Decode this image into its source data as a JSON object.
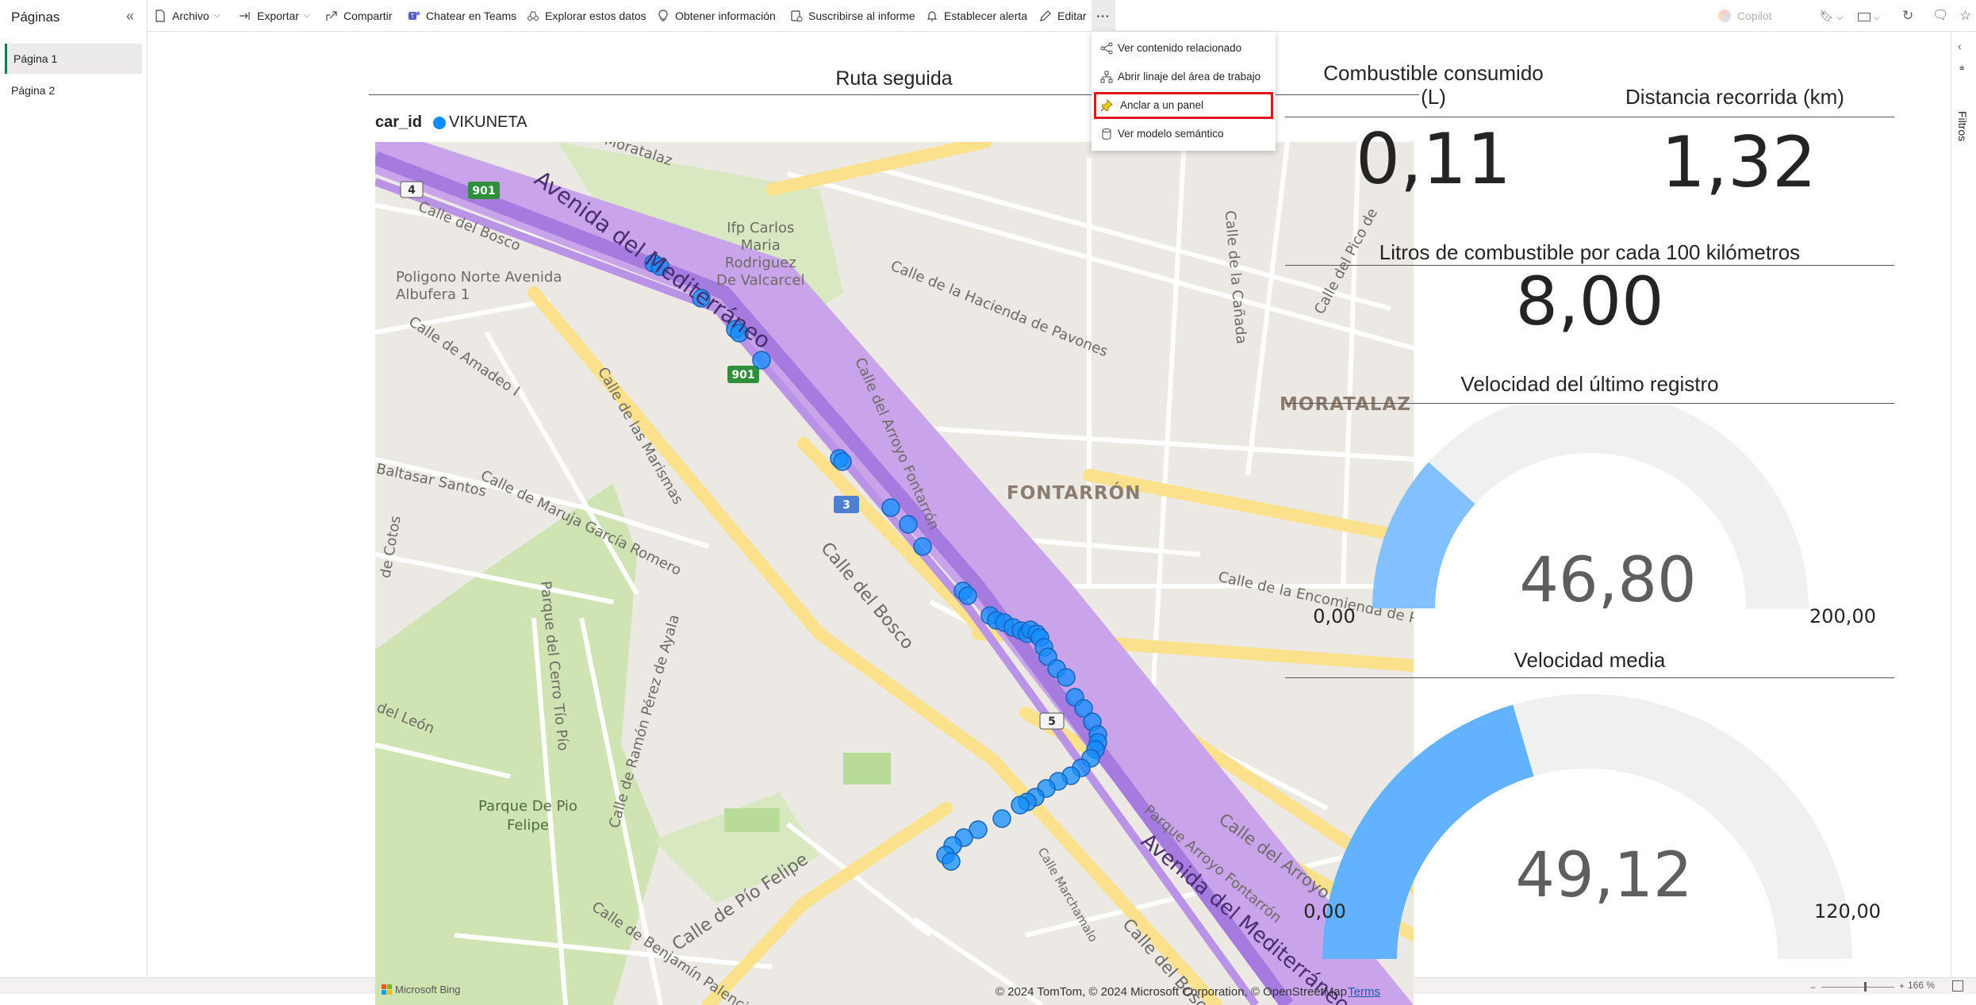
{
  "pages_pane": {
    "title": "Páginas",
    "pages": [
      {
        "label": "Página 1",
        "active": true
      },
      {
        "label": "Página 2",
        "active": false
      }
    ]
  },
  "toolbar": {
    "archivo": "Archivo",
    "exportar": "Exportar",
    "compartir": "Compartir",
    "teams": "Chatear en Teams",
    "explorar": "Explorar estos datos",
    "info": "Obtener información",
    "suscribirse": "Suscribirse al informe",
    "alerta": "Establecer alerta",
    "editar": "Editar",
    "more": "···",
    "copilot": "Copilot"
  },
  "more_menu": {
    "items": [
      {
        "label": "Ver contenido relacionado",
        "icon": "share-icon"
      },
      {
        "label": "Abrir linaje del área de trabajo",
        "icon": "lineage-icon"
      },
      {
        "label": "Anclar a un panel",
        "icon": "pin-icon",
        "highlighted": true
      },
      {
        "label": "Ver modelo semántico",
        "icon": "database-icon"
      }
    ]
  },
  "filters_pane": {
    "label": "Filtros"
  },
  "status": {
    "zoom": "166 %"
  },
  "map_visual": {
    "title": "Ruta seguida",
    "legend_title": "car_id",
    "legend_value": "VIKUNETA",
    "legend_color": "#118dff",
    "labels": {
      "moratalaz_street": "de Moratalaz",
      "ifp": "Ifp Carlos\nMaria\nRodriguez\nDe Valcarcel",
      "poligono": "Poligono Norte Avenida\nAlbufera 1",
      "calle_bosco_top": "Calle del Bosco",
      "avenida_top": "Avenida del Mediterráneo",
      "hacienda": "Calle de la Hacienda de Pavones",
      "canada": "Calle de la Cañada",
      "pico": "Calle del Pico de",
      "moratalaz": "MORATALAZ",
      "fontarron": "FONTARRÓN",
      "arroyo": "Calle del Arroyo Fontarrón",
      "amadeo": "Calle de Amadeo I",
      "marismas": "Calle de las Marismas",
      "baltasar": "Baltasar Santos",
      "maruja": "Calle de Maruja García Romero",
      "cotos": "de Cotos",
      "cerro": "Parque del Cerro Tío Pío",
      "calle_bosco_mid": "Calle del Bosco",
      "encomienda": "Calle de la Encomienda de Pal",
      "leon": "del León",
      "ramon": "Calle de Ramón Pérez de Ayala",
      "parque_pio": "Parque De Pio\nFelipe",
      "benjamin": "Calle de Benjamín Palencia",
      "pio_felipe": "Calle de Pío Felipe",
      "marchamalo": "Calle Marchamalo",
      "parque_arroyo": "Parque Arroyo Fontarrón",
      "arroyo_bottom": "Calle del Arroyo Fontarrón",
      "avenida_bottom": "Avenida del Mediterráneo",
      "bosco_bottom": "Calle del Bosco",
      "shield_901a": "901",
      "shield_901b": "901",
      "shield_4": "4",
      "shield_3": "3",
      "shield_5": "5"
    },
    "bing": "Microsoft Bing",
    "copyright": "© 2024 TomTom, © 2024 Microsoft Corporation, © OpenStreetMap",
    "terms": "Terms"
  },
  "kpis": {
    "fuel": {
      "title": "Combustible consumido\n(L)",
      "value": "0,11"
    },
    "distance": {
      "title": "Distancia recorrida (km)",
      "value": "1,32"
    },
    "per100": {
      "title": "Litros de combustible por cada 100 kilómetros",
      "value": "8,00"
    }
  },
  "gauges": [
    {
      "title": "Velocidad del último registro",
      "value": 46.8,
      "value_label": "46,80",
      "min": 0,
      "max": 200,
      "min_label": "0,00",
      "max_label": "200,00",
      "fill_color": "#82c0ff"
    },
    {
      "title": "Velocidad media",
      "value": 49.12,
      "value_label": "49,12",
      "min": 0,
      "max": 120,
      "min_label": "0,00",
      "max_label": "120,00",
      "fill_color": "#62b2ff"
    }
  ]
}
